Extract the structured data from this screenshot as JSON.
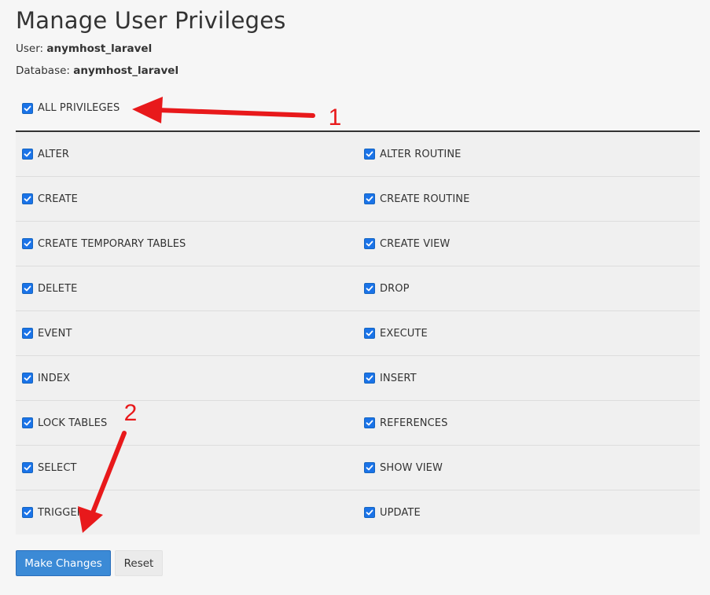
{
  "page": {
    "title": "Manage User Privileges",
    "user_label": "User:",
    "user_value": "anymhost_laravel",
    "database_label": "Database:",
    "database_value": "anymhost_laravel"
  },
  "all_privileges": {
    "label": "ALL PRIVILEGES",
    "checked": true
  },
  "privileges": {
    "rows": [
      {
        "left": "ALTER",
        "right": "ALTER ROUTINE"
      },
      {
        "left": "CREATE",
        "right": "CREATE ROUTINE"
      },
      {
        "left": "CREATE TEMPORARY TABLES",
        "right": "CREATE VIEW"
      },
      {
        "left": "DELETE",
        "right": "DROP"
      },
      {
        "left": "EVENT",
        "right": "EXECUTE"
      },
      {
        "left": "INDEX",
        "right": "INSERT"
      },
      {
        "left": "LOCK TABLES",
        "right": "REFERENCES"
      },
      {
        "left": "SELECT",
        "right": "SHOW VIEW"
      },
      {
        "left": "TRIGGER",
        "right": "UPDATE"
      }
    ],
    "all_checked": true
  },
  "buttons": {
    "make_changes": "Make Changes",
    "reset": "Reset"
  },
  "annotations": {
    "color": "#e8191b",
    "marker_1": "1",
    "marker_2": "2"
  },
  "colors": {
    "checkbox": "#1a73e8",
    "primary_button": "#3b8ad6",
    "background": "#f6f6f6",
    "row_background": "#f0f0f0"
  }
}
